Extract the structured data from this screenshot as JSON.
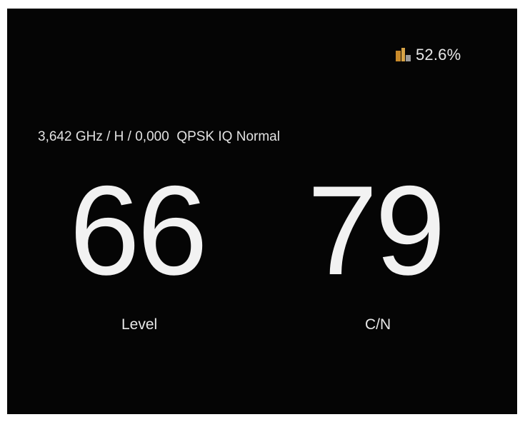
{
  "status": {
    "battery_icon": "battery-icon",
    "battery_percent": "52.6%"
  },
  "signal_info": {
    "frequency": "3,642 GHz",
    "polarization": "H",
    "symbol_rate": "0,000",
    "modulation": "QPSK",
    "iq_mode": "IQ Normal",
    "line_text": "3,642 GHz / H / 0,000  QPSK IQ Normal"
  },
  "meters": {
    "level": {
      "value": "66",
      "label": "Level"
    },
    "cn": {
      "value": "79",
      "label": "C/N"
    }
  },
  "colors": {
    "background": "#050505",
    "text": "#f2f2f2",
    "battery_accent": "#c88a2a"
  }
}
